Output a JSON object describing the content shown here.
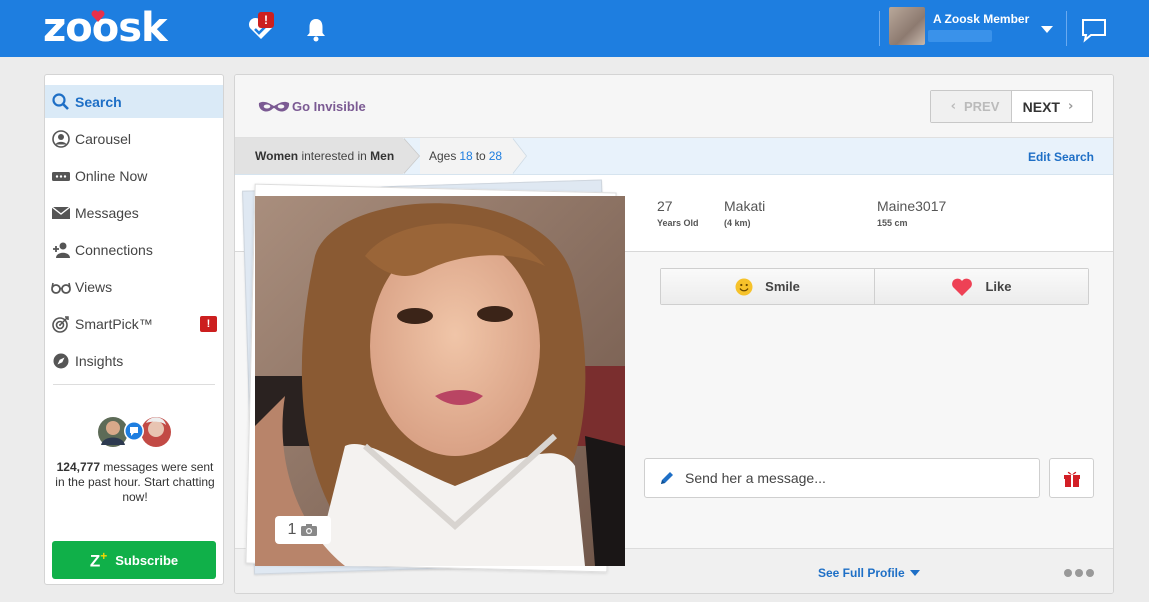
{
  "header": {
    "logo": "zoosk",
    "notification_badge": "!",
    "member_name": "A Zoosk Member",
    "icons": [
      "heart-check-icon",
      "bell-icon",
      "chevron-down-icon",
      "chat-bubble-icon"
    ],
    "brand_color": "#1e7ee0"
  },
  "sidebar": {
    "items": [
      {
        "label": "Search",
        "icon": "search-icon",
        "active": true
      },
      {
        "label": "Carousel",
        "icon": "carousel-icon"
      },
      {
        "label": "Online Now",
        "icon": "online-now-icon"
      },
      {
        "label": "Messages",
        "icon": "envelope-icon"
      },
      {
        "label": "Connections",
        "icon": "connections-icon"
      },
      {
        "label": "Views",
        "icon": "glasses-icon"
      },
      {
        "label": "SmartPick™",
        "icon": "target-icon",
        "badge": "!"
      },
      {
        "label": "Insights",
        "icon": "compass-icon"
      }
    ],
    "chat_stat": {
      "count": "124,777",
      "text": " messages were sent in the past hour. Start chatting now!"
    },
    "subscribe": {
      "z": "Z",
      "plus": "+",
      "label": "Subscribe"
    },
    "subscribe_color": "#10b049"
  },
  "main": {
    "go_invisible": "Go Invisible",
    "pager": {
      "prev": "PREV",
      "next": "NEXT"
    },
    "filter": {
      "gender": "Women",
      "interested_in": " interested in ",
      "seeking": "Men",
      "ages_label": "Ages",
      "age_min": "18",
      "to": "to",
      "age_max": "28",
      "edit": "Edit Search"
    },
    "profile": {
      "age": "27",
      "age_sub": "Years Old",
      "city": "Makati",
      "distance": "(4 km)",
      "username": "Maine3017",
      "height": "155 cm",
      "photo_count": "1"
    },
    "actions": {
      "smile": "Smile",
      "like": "Like"
    },
    "message_placeholder": "Send her a message...",
    "full_profile": "See Full Profile"
  }
}
